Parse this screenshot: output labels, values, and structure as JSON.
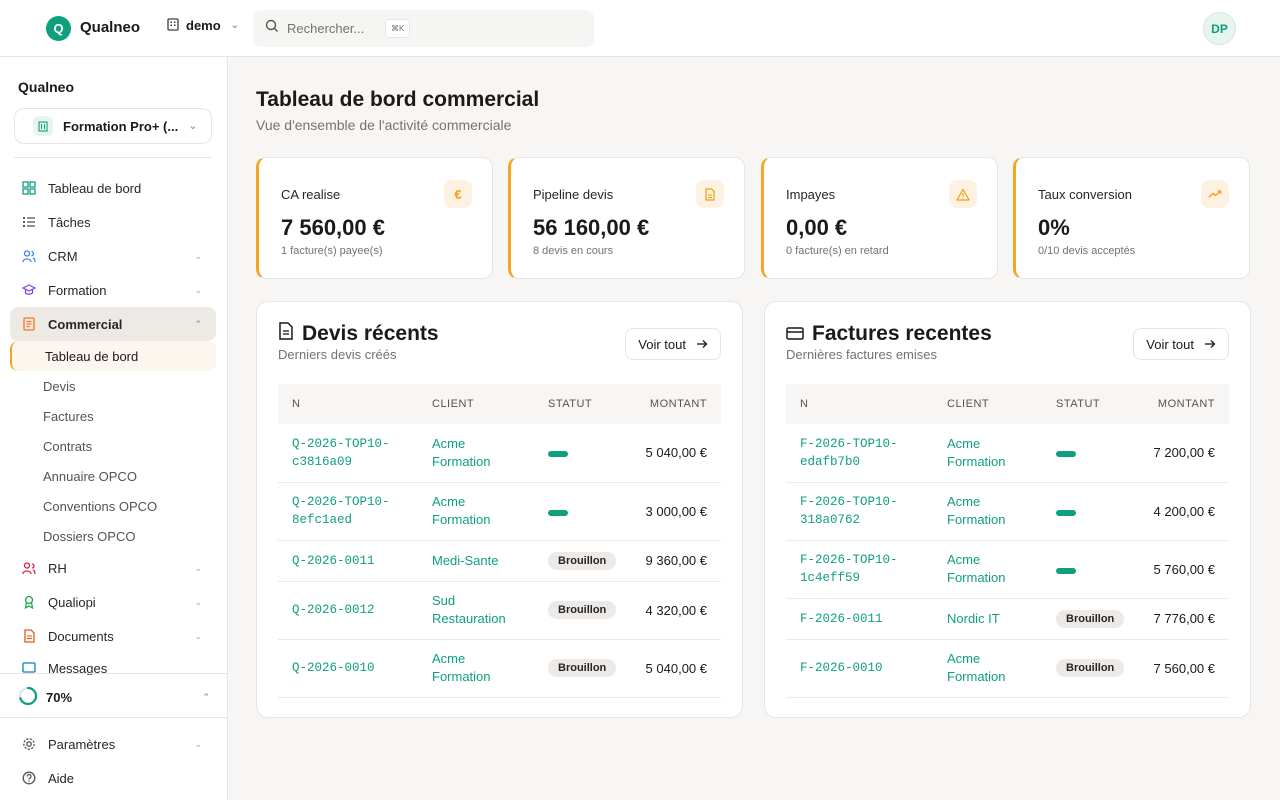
{
  "topbar": {
    "logo_letter": "Q",
    "brand": "Qualneo",
    "org": "demo",
    "search_placeholder": "Rechercher...",
    "search_shortcut": "⌘K",
    "avatar_initials": "DP"
  },
  "sidebar": {
    "title": "Qualneo",
    "tenant": "Formation Pro+ (...",
    "items": [
      {
        "label": "Tableau de bord",
        "icon": "grid-icon",
        "chevron": false
      },
      {
        "label": "Tâches",
        "icon": "list-check-icon",
        "chevron": false
      },
      {
        "label": "CRM",
        "icon": "users-icon",
        "chevron": true
      },
      {
        "label": "Formation",
        "icon": "graduation-cap-icon",
        "chevron": true
      },
      {
        "label": "Commercial",
        "icon": "receipt-icon",
        "chevron": true
      }
    ],
    "commercial_sub": [
      "Tableau de bord",
      "Devis",
      "Factures",
      "Contrats",
      "Annuaire OPCO",
      "Conventions OPCO",
      "Dossiers OPCO"
    ],
    "items_after": [
      {
        "label": "RH",
        "icon": "people-icon"
      },
      {
        "label": "Qualiopi",
        "icon": "award-icon"
      },
      {
        "label": "Documents",
        "icon": "document-icon"
      },
      {
        "label": "Messages",
        "icon": "message-icon"
      }
    ],
    "progress_label": "70%",
    "progress_value": 0.7,
    "bottom": [
      {
        "label": "Paramètres",
        "icon": "gear-icon"
      },
      {
        "label": "Aide",
        "icon": "help-circle-icon"
      }
    ]
  },
  "page": {
    "title": "Tableau de bord commercial",
    "subtitle": "Vue d'ensemble de l'activité commerciale"
  },
  "kpis": [
    {
      "label": "CA realise",
      "value": "7 560,00 €",
      "sub": "1 facture(s) payee(s)",
      "icon": "euro-icon"
    },
    {
      "label": "Pipeline devis",
      "value": "56 160,00 €",
      "sub": "8 devis en cours",
      "icon": "file-icon"
    },
    {
      "label": "Impayes",
      "value": "0,00 €",
      "sub": "0 facture(s) en retard",
      "icon": "warning-icon"
    },
    {
      "label": "Taux conversion",
      "value": "0%",
      "sub": "0/10 devis acceptés",
      "icon": "trending-up-icon"
    }
  ],
  "devis": {
    "title": "Devis récents",
    "subtitle": "Derniers devis créés",
    "voir_tout": "Voir tout",
    "columns": [
      "N",
      "CLIENT",
      "STATUT",
      "MONTANT"
    ],
    "rows": [
      {
        "num": [
          "Q-2026-TOP10-",
          "c3816a09"
        ],
        "client": [
          "Acme",
          "Formation"
        ],
        "status": "",
        "amount": "5 040,00 €"
      },
      {
        "num": [
          "Q-2026-TOP10-",
          "8efc1aed"
        ],
        "client": [
          "Acme",
          "Formation"
        ],
        "status": "",
        "amount": "3 000,00 €"
      },
      {
        "num": [
          "Q-2026-0011"
        ],
        "client": [
          "Medi-Sante"
        ],
        "status": "Brouillon",
        "amount": "9 360,00 €"
      },
      {
        "num": [
          "Q-2026-0012"
        ],
        "client": [
          "Sud",
          "Restauration"
        ],
        "status": "Brouillon",
        "amount": "4 320,00 €"
      },
      {
        "num": [
          "Q-2026-0010"
        ],
        "client": [
          "Acme",
          "Formation"
        ],
        "status": "Brouillon",
        "amount": "5 040,00 €"
      }
    ]
  },
  "factures": {
    "title": "Factures recentes",
    "subtitle": "Dernières factures emises",
    "voir_tout": "Voir tout",
    "columns": [
      "N",
      "CLIENT",
      "STATUT",
      "MONTANT"
    ],
    "rows": [
      {
        "num": [
          "F-2026-TOP10-",
          "edafb7b0"
        ],
        "client": [
          "Acme",
          "Formation"
        ],
        "status": "",
        "amount": "7 200,00 €"
      },
      {
        "num": [
          "F-2026-TOP10-",
          "318a0762"
        ],
        "client": [
          "Acme",
          "Formation"
        ],
        "status": "",
        "amount": "4 200,00 €"
      },
      {
        "num": [
          "F-2026-TOP10-",
          "1c4eff59"
        ],
        "client": [
          "Acme",
          "Formation"
        ],
        "status": "",
        "amount": "5 760,00 €"
      },
      {
        "num": [
          "F-2026-0011"
        ],
        "client": [
          "Nordic IT"
        ],
        "status": "Brouillon",
        "amount": "7 776,00 €"
      },
      {
        "num": [
          "F-2026-0010"
        ],
        "client": [
          "Acme",
          "Formation"
        ],
        "status": "Brouillon",
        "amount": "7 560,00 €"
      }
    ]
  },
  "colors": {
    "brand": "#0f9f7f",
    "accent": "#f5a524"
  }
}
